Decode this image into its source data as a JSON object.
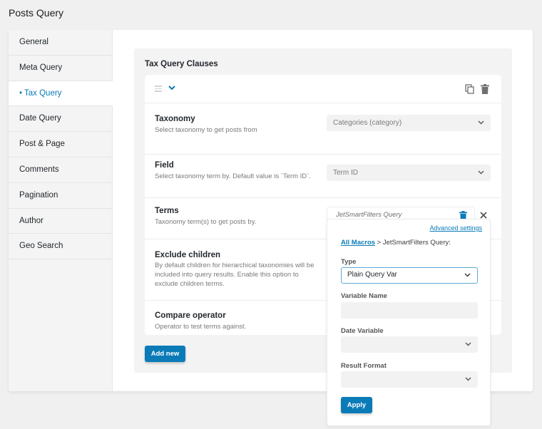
{
  "page": {
    "title": "Posts Query"
  },
  "colors": {
    "accent": "#0b7bb8",
    "focus_border": "#5ea9d6",
    "icon_gray": "#6f6f6f"
  },
  "sidebar": {
    "items": [
      {
        "label": "General",
        "active": false
      },
      {
        "label": "Meta Query",
        "active": false
      },
      {
        "label": "• Tax Query",
        "active": true
      },
      {
        "label": "Date Query",
        "active": false
      },
      {
        "label": "Post & Page",
        "active": false
      },
      {
        "label": "Comments",
        "active": false
      },
      {
        "label": "Pagination",
        "active": false
      },
      {
        "label": "Author",
        "active": false
      },
      {
        "label": "Geo Search",
        "active": false
      }
    ]
  },
  "clauses": {
    "title": "Tax Query Clauses",
    "header_icons": [
      "drag-handle-icon",
      "chevron-down-icon",
      "copy-icon",
      "trash-icon"
    ],
    "fields": {
      "taxonomy": {
        "label": "Taxonomy",
        "description": "Select taxonomy to get posts from",
        "value": "Categories (category)"
      },
      "field": {
        "label": "Field",
        "description": "Select taxonomy term by. Default value is `Term ID`.",
        "value": "Term ID"
      },
      "terms": {
        "label": "Terms",
        "description": "Taxonomy term(s) to get posts by.",
        "value": "JetSmartFilters Query"
      },
      "exclude_children": {
        "label": "Exclude children",
        "description": "By default children for hierarchical taxonomies will be included into query results. Enable this option to exclude children terms."
      },
      "compare_operator": {
        "label": "Compare operator",
        "description": "Operator to test terms against."
      }
    },
    "add_new_label": "Add new"
  },
  "popup": {
    "advanced_settings_label": "Advanced settings",
    "breadcrumb_link": "All Macros",
    "breadcrumb_rest": " > JetSmartFilters Query:",
    "type": {
      "label": "Type",
      "value": "Plain Query Var"
    },
    "variable_name": {
      "label": "Variable Name",
      "value": ""
    },
    "date_variable": {
      "label": "Date Variable",
      "value": ""
    },
    "result_format": {
      "label": "Result Format",
      "value": ""
    },
    "apply_label": "Apply"
  }
}
